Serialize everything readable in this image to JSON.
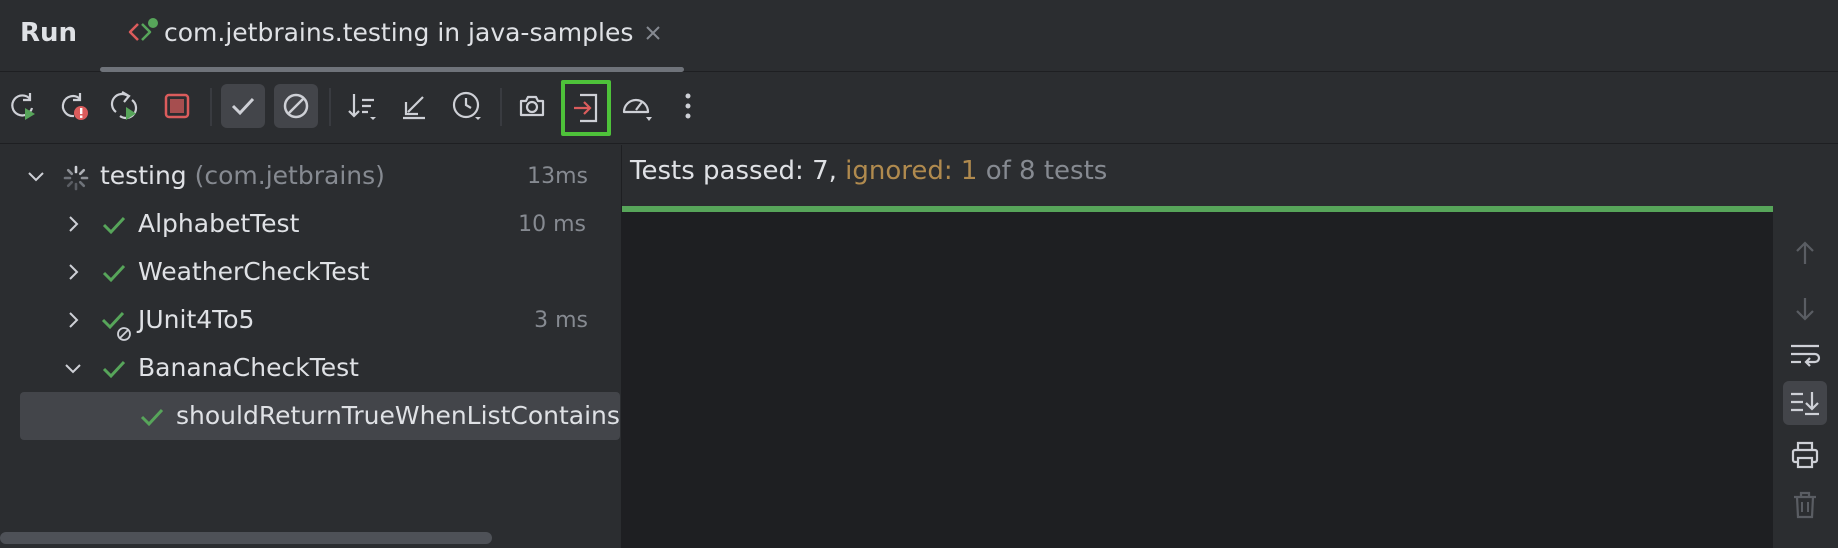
{
  "header": {
    "title": "Run",
    "tab": {
      "label": "com.jetbrains.testing in java-samples"
    }
  },
  "toolbar": {
    "buttons": [
      {
        "name": "rerun-button",
        "icon": "rerun-icon"
      },
      {
        "name": "rerun-failed-button",
        "icon": "rerun-failed-icon"
      },
      {
        "name": "toggle-auto-test-button",
        "icon": "auto-rerun-icon"
      },
      {
        "name": "stop-button",
        "icon": "stop-icon"
      },
      {
        "name": "show-passed-button",
        "icon": "check-icon"
      },
      {
        "name": "show-ignored-button",
        "icon": "ignored-icon"
      },
      {
        "name": "sort-button",
        "icon": "sort-icon"
      },
      {
        "name": "collapse-all-button",
        "icon": "collapse-icon"
      },
      {
        "name": "test-history-button",
        "icon": "history-icon"
      },
      {
        "name": "export-results-button",
        "icon": "camera-icon"
      },
      {
        "name": "import-tests-button",
        "icon": "import-icon"
      },
      {
        "name": "test-settings-button",
        "icon": "speedometer-icon"
      },
      {
        "name": "more-button",
        "icon": "more-vertical-icon"
      }
    ]
  },
  "tree": {
    "root": {
      "label": "testing",
      "pkg": "(com.jetbrains)",
      "time": "13ms"
    },
    "items": [
      {
        "label": "AlphabetTest",
        "time": "10 ms"
      },
      {
        "label": "WeatherCheckTest",
        "time": ""
      },
      {
        "label": "JUnit4To5",
        "time": "3 ms"
      },
      {
        "label": "BananaCheckTest",
        "time": ""
      },
      {
        "label": "shouldReturnTrueWhenListContains",
        "time": ""
      }
    ]
  },
  "console": {
    "summary": {
      "passed": "Tests passed: 7, ",
      "ignored": "ignored: 1",
      "total": " of 8 tests"
    },
    "progress_percent": 100
  },
  "colors": {
    "accent_green": "#57a55a",
    "highlight_green": "#4ec23a",
    "ignored": "#b08a4e",
    "stop_red": "#db5c5c"
  }
}
